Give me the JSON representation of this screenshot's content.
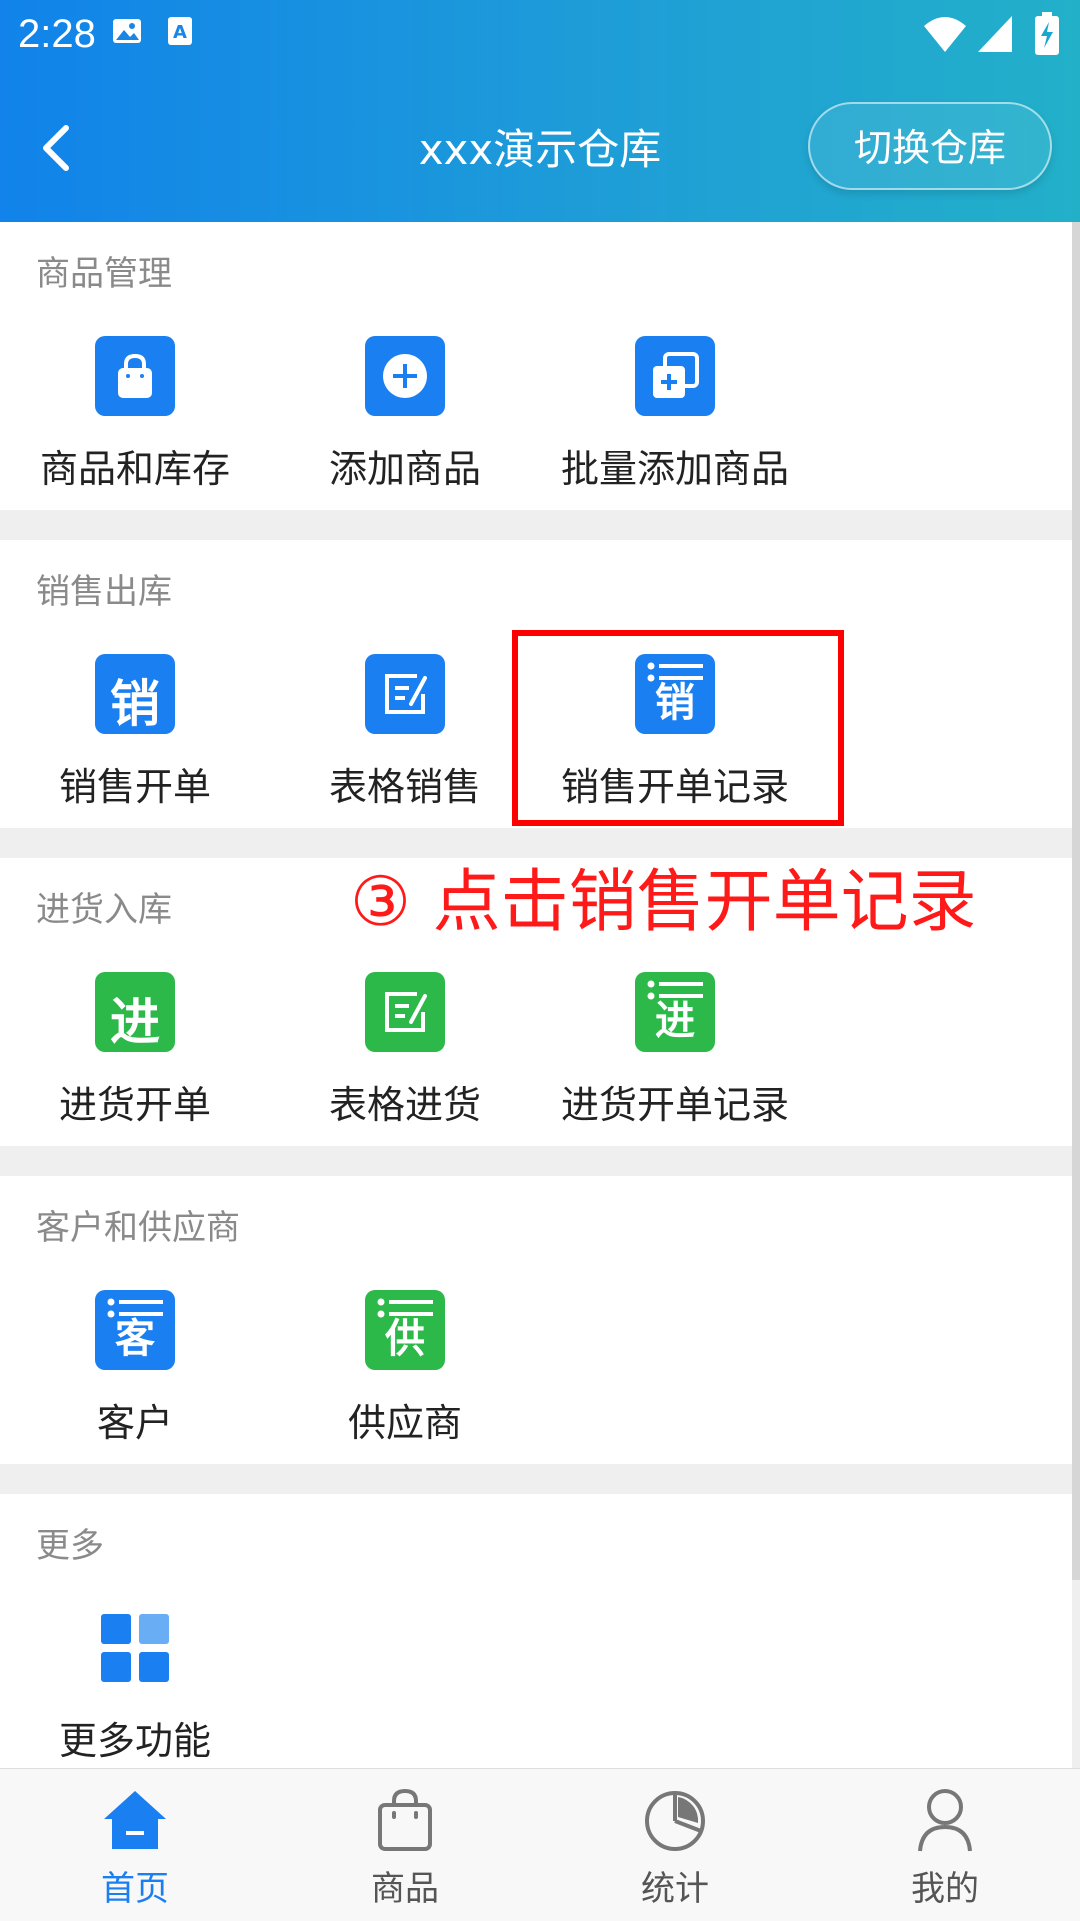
{
  "status_bar": {
    "time": "2:28"
  },
  "header": {
    "title": "xxx演示仓库",
    "switch_button": "切换仓库"
  },
  "sections": {
    "goods": {
      "title": "商品管理",
      "items": [
        "商品和库存",
        "添加商品",
        "批量添加商品"
      ]
    },
    "sales": {
      "title": "销售出库",
      "items": [
        "销售开单",
        "表格销售",
        "销售开单记录"
      ],
      "icon_chars": [
        "销",
        "销"
      ]
    },
    "purchase": {
      "title": "进货入库",
      "items": [
        "进货开单",
        "表格进货",
        "进货开单记录"
      ],
      "icon_chars": [
        "进",
        "进"
      ]
    },
    "contacts": {
      "title": "客户和供应商",
      "items": [
        "客户",
        "供应商"
      ],
      "icon_chars": [
        "客",
        "供"
      ]
    },
    "more": {
      "title": "更多",
      "items": [
        "更多功能"
      ]
    }
  },
  "annotation": {
    "text": "③ 点击销售开单记录",
    "color": "#ff1a1a"
  },
  "tabbar": {
    "tabs": [
      "首页",
      "商品",
      "统计",
      "我的"
    ],
    "active": "首页"
  },
  "colors": {
    "accent": "#1a7ff0",
    "green": "#2db84a",
    "highlight": "#ff0000"
  }
}
